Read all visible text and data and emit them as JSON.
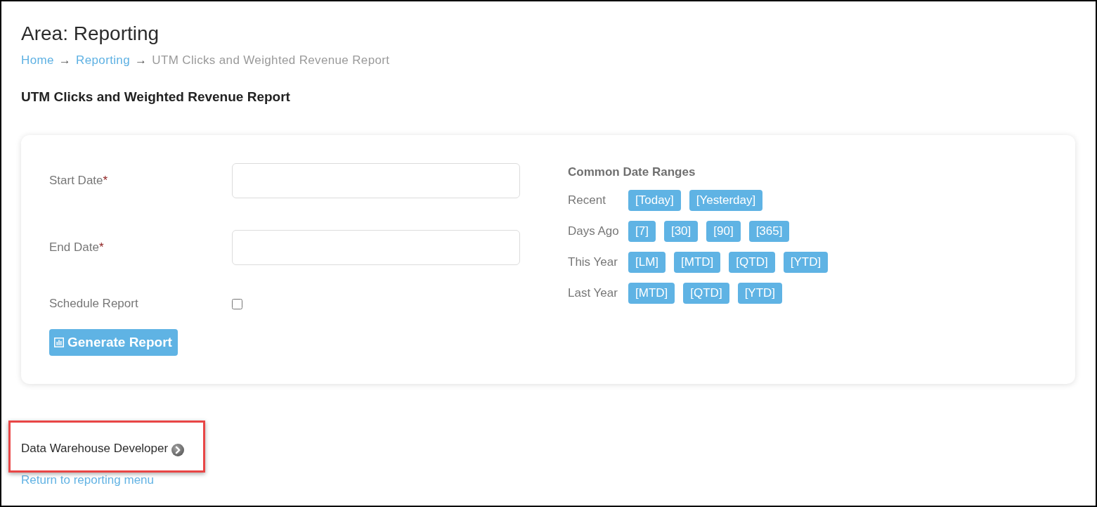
{
  "page": {
    "area_title": "Area: Reporting"
  },
  "breadcrumb": [
    {
      "label": "Home",
      "kind": "link"
    },
    {
      "label": "→",
      "kind": "separator"
    },
    {
      "label": "Reporting",
      "kind": "link"
    },
    {
      "label": "→",
      "kind": "separator"
    },
    {
      "label": "UTM Clicks and Weighted Revenue Report",
      "kind": "current"
    }
  ],
  "report_title": "UTM Clicks and Weighted Revenue Report",
  "form": {
    "fields": [
      {
        "label": "Start Date",
        "required_mark": "*",
        "kind": "date"
      },
      {
        "label": "End Date",
        "required_mark": "*",
        "kind": "date"
      },
      {
        "label": "Schedule Report",
        "kind": "checkbox",
        "checked": false
      }
    ],
    "submit_button": "Generate Report"
  },
  "date_ranges": {
    "title": "Common Date Ranges",
    "rows": [
      {
        "label": "Recent",
        "buttons": [
          "[Today]",
          "[Yesterday]"
        ]
      },
      {
        "label": "Days Ago",
        "buttons": [
          "[7]",
          "[30]",
          "[90]",
          "[365]"
        ]
      },
      {
        "label": "This Year",
        "buttons": [
          "[LM]",
          "[MTD]",
          "[QTD]",
          "[YTD]"
        ]
      },
      {
        "label": "Last Year",
        "buttons": [
          "[MTD]",
          "[QTD]",
          "[YTD]"
        ]
      }
    ]
  },
  "footer": {
    "role": {
      "label": "Data Warehouse Developer",
      "highlighted": true
    },
    "return_link": "Return to reporting menu"
  }
}
